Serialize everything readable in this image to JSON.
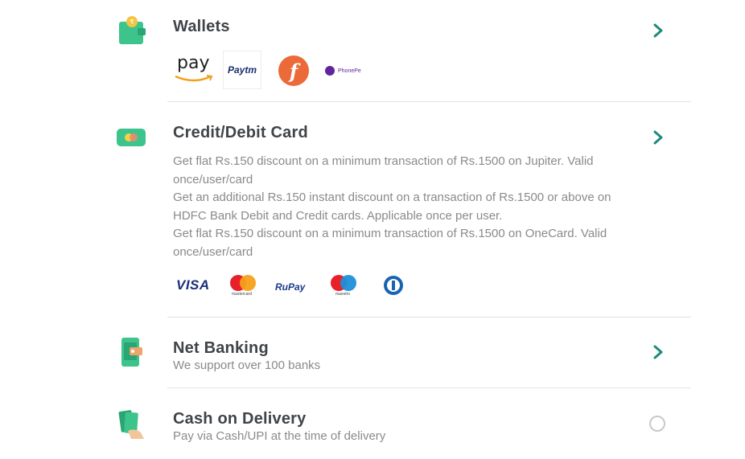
{
  "payment_methods": {
    "wallets": {
      "title": "Wallets",
      "logos": {
        "amazon_pay": "pay",
        "paytm": "Paytm",
        "freecharge": "f",
        "phonepe": "PhonePe"
      }
    },
    "cards": {
      "title": "Credit/Debit Card",
      "offers": [
        "Get flat Rs.150 discount on a minimum transaction of Rs.1500 on Jupiter. Valid once/user/card",
        "Get an additional Rs.150 instant discount on a transaction of Rs.1500 or above on HDFC Bank Debit and Credit cards. Applicable once per user.",
        "Get flat Rs.150 discount on a minimum transaction of Rs.1500 on OneCard. Valid once/user/card"
      ],
      "networks": {
        "visa": "VISA",
        "mastercard": "mastercard",
        "rupay": "RuPay",
        "maestro": "maestro",
        "diners": "Diners Club"
      }
    },
    "net_banking": {
      "title": "Net Banking",
      "subtitle": "We support over 100 banks"
    },
    "cod": {
      "title": "Cash on Delivery",
      "subtitle": "Pay via Cash/UPI at the time of delivery"
    }
  },
  "colors": {
    "accent": "#1f8a7a",
    "icon_green": "#3dc48c",
    "title": "#3f4449",
    "muted": "#8a8a8a"
  }
}
